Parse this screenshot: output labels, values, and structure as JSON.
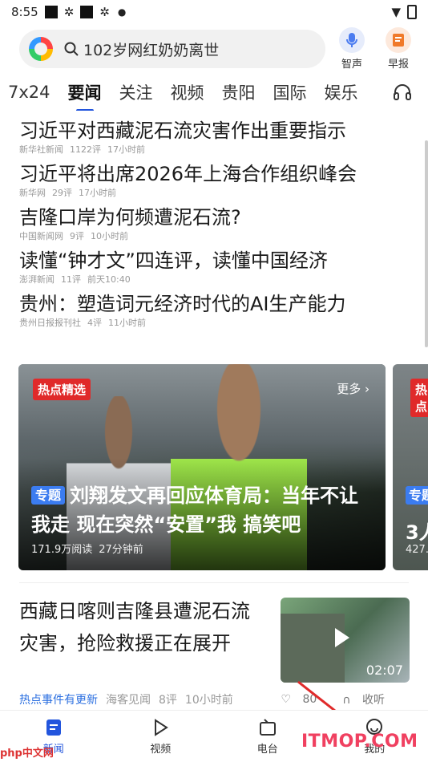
{
  "status": {
    "time": "8:55"
  },
  "search": {
    "query": "102岁网红奶奶离世"
  },
  "top_actions": [
    {
      "label": "智声"
    },
    {
      "label": "早报"
    }
  ],
  "tabs": [
    "7x24",
    "要闻",
    "关注",
    "视频",
    "贵阳",
    "国际",
    "娱乐"
  ],
  "news": [
    {
      "title": "习近平对西藏泥石流灾害作出重要指示",
      "source": "新华社新闻",
      "comments": "1122评",
      "time": "17小时前"
    },
    {
      "title": "习近平将出席2026年上海合作组织峰会",
      "source": "新华网",
      "comments": "29评",
      "time": "17小时前"
    },
    {
      "title": "吉隆口岸为何频遭泥石流?",
      "source": "中国新闻网",
      "comments": "9评",
      "time": "10小时前"
    },
    {
      "title": "读懂“钟才文”四连评，读懂中国经济",
      "source": "澎湃新闻",
      "comments": "11评",
      "time": "前天10:40"
    },
    {
      "title": "贵州：塑造词元经济时代的AI生产能力",
      "source": "贵州日报报刊社",
      "comments": "4评",
      "time": "11小时前"
    }
  ],
  "carousel": {
    "badge": "热点精选",
    "more": "更多 ›",
    "tag": "专题",
    "title": "刘翔发文再回应体育局：当年不让我走 现在突然“安置”我 搞笑吧",
    "reads": "171.9万阅读",
    "ago": "27分钟前",
    "next_badge": "热点",
    "next_tag": "专题",
    "next_line2": "3人",
    "next_meta": "427."
  },
  "story": {
    "title": "西藏日喀则吉隆县遭泥石流灾害，抢险救援正在展开",
    "duration": "02:07",
    "hot": "热点事件有更新",
    "source": "海客见闻",
    "comments": "8评",
    "time": "10小时前",
    "likes": "80",
    "listen": "收听"
  },
  "bottom_nav": [
    {
      "label": "新闻"
    },
    {
      "label": "视频"
    },
    {
      "label": "电台"
    },
    {
      "label": "我的"
    }
  ],
  "watermark": {
    "text": "ITMOP.COM",
    "left": "php中文网"
  }
}
